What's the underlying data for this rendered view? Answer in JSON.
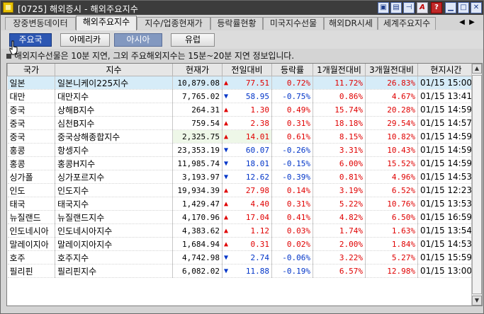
{
  "window": {
    "title": "[0725] 해외증시 - 해외주요지수",
    "controls": [
      "window-a-icon",
      "window-b-icon",
      "pin-icon",
      "A",
      "?",
      "minimize-icon",
      "maximize-icon",
      "close-icon"
    ]
  },
  "tabs": [
    {
      "label": "장중변동데이터"
    },
    {
      "label": "해외주요지수"
    },
    {
      "label": "지수/업종현재가"
    },
    {
      "label": "등락률현황"
    },
    {
      "label": "미국지수선물"
    },
    {
      "label": "해외DR시세"
    },
    {
      "label": "세계주요지수"
    }
  ],
  "subtabs": [
    {
      "label": "주요국"
    },
    {
      "label": "아메리카"
    },
    {
      "label": "아시아"
    },
    {
      "label": "유럽"
    }
  ],
  "notice": "해외지수선물은 10분 지연, 그외 주요해외지수는 15분~20분 지연 정보입니다.",
  "table": {
    "headers": [
      "국가",
      "지수",
      "현재가",
      "전일대비",
      "등락률",
      "1개월전대비",
      "3개월전대비",
      "현지시간"
    ],
    "rows": [
      {
        "country": "일본",
        "index": "일본니케이225지수",
        "price": "10,879.08",
        "dir": "up",
        "change": "77.51",
        "rate": "0.72%",
        "m1": "11.72%",
        "m3": "26.83%",
        "time": "01/15 15:00"
      },
      {
        "country": "대만",
        "index": "대만지수",
        "price": "7,765.02",
        "dir": "down",
        "change": "58.95",
        "rate": "-0.75%",
        "m1": "0.86%",
        "m3": "4.67%",
        "time": "01/15 13:41"
      },
      {
        "country": "중국",
        "index": "상해B지수",
        "price": "264.31",
        "dir": "up",
        "change": "1.30",
        "rate": "0.49%",
        "m1": "15.74%",
        "m3": "20.28%",
        "time": "01/15 14:59"
      },
      {
        "country": "중국",
        "index": "심천B지수",
        "price": "759.54",
        "dir": "up",
        "change": "2.38",
        "rate": "0.31%",
        "m1": "18.18%",
        "m3": "29.54%",
        "time": "01/15 14:57"
      },
      {
        "country": "중국",
        "index": "중국상해종합지수",
        "price": "2,325.75",
        "dir": "up",
        "change": "14.01",
        "rate": "0.61%",
        "m1": "8.15%",
        "m3": "10.82%",
        "time": "01/15 14:59"
      },
      {
        "country": "홍콩",
        "index": "항셍지수",
        "price": "23,353.19",
        "dir": "down",
        "change": "60.07",
        "rate": "-0.26%",
        "m1": "3.31%",
        "m3": "10.43%",
        "time": "01/15 14:59"
      },
      {
        "country": "홍콩",
        "index": "홍콩H지수",
        "price": "11,985.74",
        "dir": "down",
        "change": "18.01",
        "rate": "-0.15%",
        "m1": "6.00%",
        "m3": "15.52%",
        "time": "01/15 14:59"
      },
      {
        "country": "싱가폴",
        "index": "싱가포르지수",
        "price": "3,193.97",
        "dir": "down",
        "change": "12.62",
        "rate": "-0.39%",
        "m1": "0.81%",
        "m3": "4.96%",
        "time": "01/15 14:53"
      },
      {
        "country": "인도",
        "index": "인도지수",
        "price": "19,934.39",
        "dir": "up",
        "change": "27.98",
        "rate": "0.14%",
        "m1": "3.19%",
        "m3": "6.52%",
        "time": "01/15 12:23"
      },
      {
        "country": "태국",
        "index": "태국지수",
        "price": "1,429.47",
        "dir": "up",
        "change": "4.40",
        "rate": "0.31%",
        "m1": "5.22%",
        "m3": "10.76%",
        "time": "01/15 13:53"
      },
      {
        "country": "뉴질랜드",
        "index": "뉴질랜드지수",
        "price": "4,170.96",
        "dir": "up",
        "change": "17.04",
        "rate": "0.41%",
        "m1": "4.82%",
        "m3": "6.50%",
        "time": "01/15 16:59"
      },
      {
        "country": "인도네시아",
        "index": "인도네시아지수",
        "price": "4,383.62",
        "dir": "up",
        "change": "1.12",
        "rate": "0.03%",
        "m1": "1.74%",
        "m3": "1.63%",
        "time": "01/15 13:54"
      },
      {
        "country": "말레이지아",
        "index": "말레이지아지수",
        "price": "1,684.94",
        "dir": "up",
        "change": "0.31",
        "rate": "0.02%",
        "m1": "2.00%",
        "m3": "1.84%",
        "time": "01/15 14:53"
      },
      {
        "country": "호주",
        "index": "호주지수",
        "price": "4,742.98",
        "dir": "down",
        "change": "2.74",
        "rate": "-0.06%",
        "m1": "3.22%",
        "m3": "5.27%",
        "time": "01/15 15:59"
      },
      {
        "country": "필리핀",
        "index": "필리핀지수",
        "price": "6,082.02",
        "dir": "down",
        "change": "11.88",
        "rate": "-0.19%",
        "m1": "6.57%",
        "m3": "12.98%",
        "time": "01/15 13:00"
      }
    ]
  },
  "colors": {
    "up": "#e00000",
    "down": "#0034c8",
    "selected_row": "#d6ecf8",
    "active_subtab": "#2d57b3"
  }
}
